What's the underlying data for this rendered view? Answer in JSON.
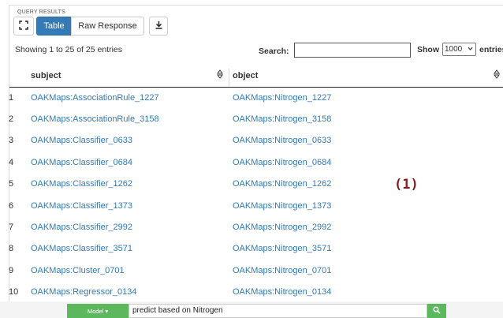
{
  "panel": {
    "title": "QUERY RESULTS"
  },
  "toolbar": {
    "expand_icon": "expand-icon",
    "table_label": "Table",
    "raw_label": "Raw Response",
    "download_icon": "download-icon"
  },
  "info": {
    "entries_text": "Showing 1 to 25 of 25 entries"
  },
  "search": {
    "label": "Search:",
    "value": ""
  },
  "length": {
    "show_label": "Show",
    "selected": "1000",
    "entries_label": "entries"
  },
  "table": {
    "columns": [
      "subject",
      "object"
    ],
    "rows": [
      {
        "num": "1",
        "subject": "OAKMaps:AssociationRule_1227",
        "object": "OAKMaps:Nitrogen_1227"
      },
      {
        "num": "2",
        "subject": "OAKMaps:AssociationRule_3158",
        "object": "OAKMaps:Nitrogen_3158"
      },
      {
        "num": "3",
        "subject": "OAKMaps:Classifier_0633",
        "object": "OAKMaps:Nitrogen_0633"
      },
      {
        "num": "4",
        "subject": "OAKMaps:Classifier_0684",
        "object": "OAKMaps:Nitrogen_0684"
      },
      {
        "num": "5",
        "subject": "OAKMaps:Classifier_1262",
        "object": "OAKMaps:Nitrogen_1262"
      },
      {
        "num": "6",
        "subject": "OAKMaps:Classifier_1373",
        "object": "OAKMaps:Nitrogen_1373"
      },
      {
        "num": "7",
        "subject": "OAKMaps:Classifier_2992",
        "object": "OAKMaps:Nitrogen_2992"
      },
      {
        "num": "8",
        "subject": "OAKMaps:Classifier_3571",
        "object": "OAKMaps:Nitrogen_3571"
      },
      {
        "num": "9",
        "subject": "OAKMaps:Cluster_0701",
        "object": "OAKMaps:Nitrogen_0701"
      },
      {
        "num": "10",
        "subject": "OAKMaps:Regressor_0134",
        "object": "OAKMaps:Nitrogen_0134"
      }
    ]
  },
  "annotation": {
    "label": "(1)"
  },
  "bottom": {
    "model_label": "Model ▾",
    "query": "predict based on Nitrogen",
    "search_icon": "search-icon",
    "colors": {
      "green": "#5cb85c",
      "link": "#337ab7",
      "primary": "#337ab7"
    }
  }
}
